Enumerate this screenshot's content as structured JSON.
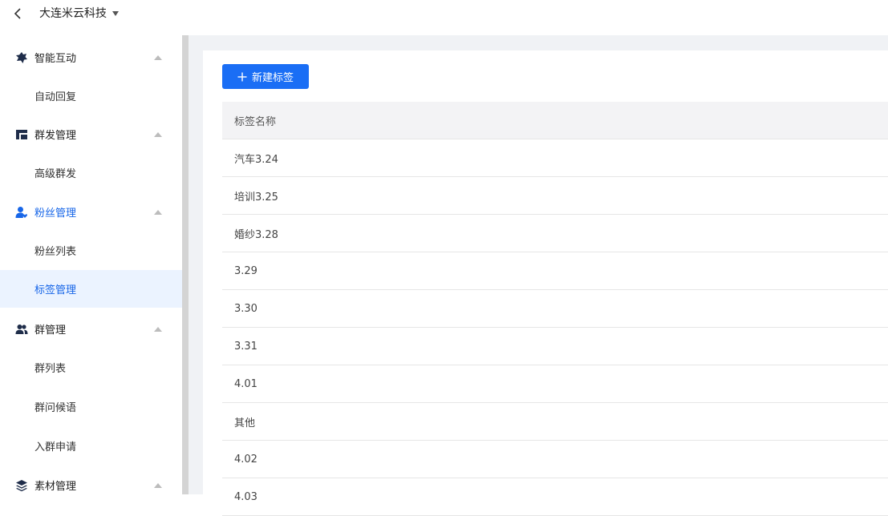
{
  "header": {
    "company": "大连米云科技"
  },
  "sidebar": {
    "groups": [
      {
        "label": "智能互动",
        "icon": "gear-badge-icon",
        "items": [
          "自动回复"
        ]
      },
      {
        "label": "群发管理",
        "icon": "stacked-cards-icon",
        "items": [
          "高级群发"
        ]
      },
      {
        "label": "粉丝管理",
        "icon": "user-heart-icon",
        "items": [
          "粉丝列表",
          "标签管理"
        ]
      },
      {
        "label": "群管理",
        "icon": "users-icon",
        "items": [
          "群列表",
          "群问候语",
          "入群申请"
        ]
      },
      {
        "label": "素材管理",
        "icon": "layers-icon",
        "items": []
      }
    ],
    "active_group": "粉丝管理",
    "active_item": "标签管理"
  },
  "toolbar": {
    "new_label": "新建标签"
  },
  "table": {
    "header": "标签名称",
    "rows": [
      "汽车3.24",
      "培训3.25",
      "婚纱3.28",
      "3.29",
      "3.30",
      "3.31",
      "4.01",
      "其他",
      "4.02",
      "4.03"
    ]
  },
  "colors": {
    "accent": "#1a6ef5",
    "active_bg": "#ebf3ff",
    "active_text": "#1766e8",
    "content_bg": "#f0f2f5"
  }
}
